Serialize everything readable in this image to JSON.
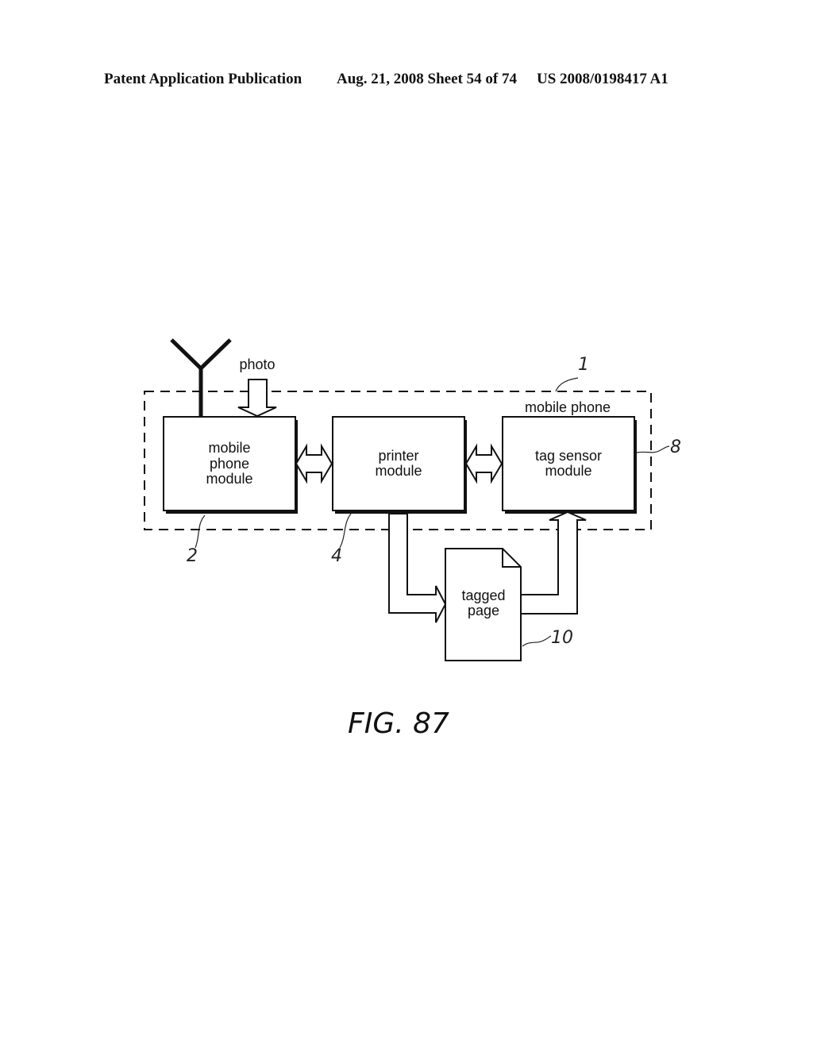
{
  "header": {
    "publication": "Patent Application Publication",
    "date_sheet": "Aug. 21, 2008  Sheet 54 of 74",
    "number": "US 2008/0198417 A1"
  },
  "diagram": {
    "container_label": "mobile phone",
    "container_ref": "1",
    "input_label": "photo",
    "blocks": [
      {
        "lines": [
          "mobile",
          "phone",
          "module"
        ],
        "ref": "2"
      },
      {
        "lines": [
          "printer",
          "module"
        ],
        "ref": "4"
      },
      {
        "lines": [
          "tag sensor",
          "module"
        ],
        "ref": "8"
      }
    ],
    "page": {
      "lines": [
        "tagged",
        "page"
      ],
      "ref": "10"
    }
  },
  "figure_label": "FIG. 87"
}
